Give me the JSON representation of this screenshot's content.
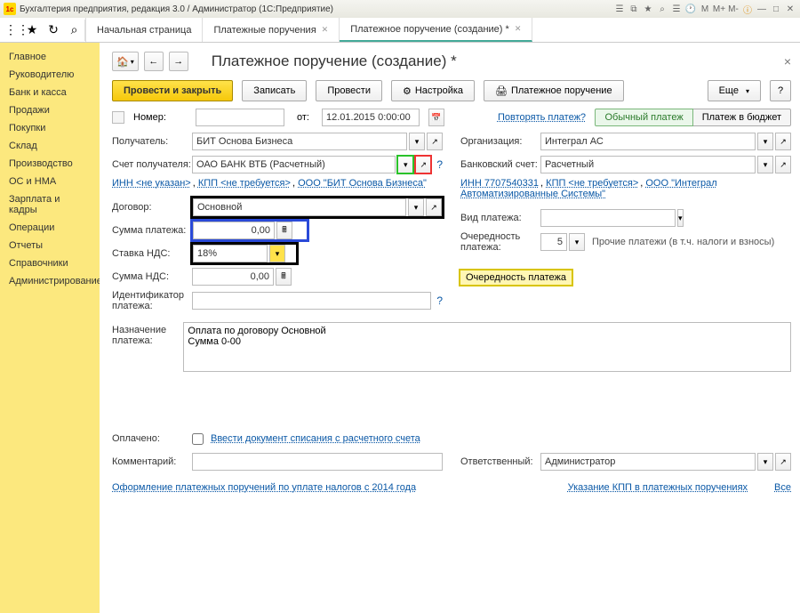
{
  "titlebar": {
    "app": "Бухгалтерия предприятия, редакция 3.0 / Администратор  (1С:Предприятие)"
  },
  "top_tabs": {
    "tab0": "Начальная страница",
    "tab1": "Платежные поручения",
    "tab2": "Платежное поручение (создание) *"
  },
  "sidebar": {
    "items": [
      "Главное",
      "Руководителю",
      "Банк и касса",
      "Продажи",
      "Покупки",
      "Склад",
      "Производство",
      "ОС и НМА",
      "Зарплата и кадры",
      "Операции",
      "Отчеты",
      "Справочники",
      "Администрирование"
    ]
  },
  "page": {
    "title": "Платежное поручение (создание) *"
  },
  "toolbar": {
    "post_close": "Провести и закрыть",
    "write": "Записать",
    "post": "Провести",
    "settings": "Настройка",
    "print": "Платежное поручение",
    "more": "Еще"
  },
  "mode": {
    "ordinary": "Обычный платеж",
    "budget": "Платеж в бюджет",
    "repeat": "Повторять платеж?"
  },
  "labels": {
    "number": "Номер:",
    "from": "от:",
    "date": "12.01.2015 0:00:00",
    "recipient": "Получатель:",
    "recipient_account": "Счет получателя:",
    "contract": "Договор:",
    "amount": "Сумма платежа:",
    "vat_rate": "Ставка НДС:",
    "vat_sum": "Сумма НДС:",
    "payer_id": "Идентификатор платежа:",
    "purpose": "Назначение платежа:",
    "paid": "Оплачено:",
    "enter_doc": "Ввести документ списания с расчетного счета",
    "comment": "Комментарий:",
    "organization": "Организация:",
    "bank_account": "Банковский счет:",
    "payment_type": "Вид платежа:",
    "priority": "Очередность платежа:",
    "priority_hint": "Прочие платежи (в т.ч. налоги и взносы)",
    "responsible": "Ответственный:",
    "priority_box": "Очередность платежа"
  },
  "values": {
    "recipient": "БИТ Основа Бизнеса",
    "recipient_account": "ОАО БАНК ВТБ (Расчетный)",
    "contract": "Основной",
    "amount": "0,00",
    "vat_rate": "18%",
    "vat_sum": "0,00",
    "organization": "Интеграл АС",
    "bank_account": "Расчетный",
    "priority": "5",
    "responsible": "Администратор",
    "purpose": "Оплата по договору Основной\nСумма 0-00"
  },
  "links": {
    "left_inn": "ИНН <не указан>",
    "left_kpp": "КПП <не требуется>",
    "left_org": "ООО \"БИТ Основа Бизнеса\"",
    "right_inn": "ИНН 7707540331",
    "right_kpp": "КПП <не требуется>",
    "right_org": "ООО \"Интеграл Автоматизированные Системы\"",
    "tax_note": "Оформление платежных поручений по уплате налогов с 2014 года",
    "kpp_note": "Указание КПП в платежных поручениях",
    "all": "Все"
  }
}
